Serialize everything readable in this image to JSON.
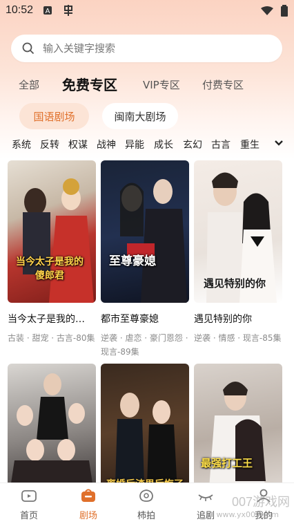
{
  "status": {
    "time": "10:52"
  },
  "search": {
    "placeholder": "输入关键字搜索"
  },
  "tabs": [
    {
      "label": "全部"
    },
    {
      "label": "免费专区"
    },
    {
      "label": "VIP专区"
    },
    {
      "label": "付费专区"
    }
  ],
  "regions": [
    {
      "label": "国语剧场"
    },
    {
      "label": "闽南大剧场"
    }
  ],
  "genres": [
    "系统",
    "反转",
    "权谋",
    "战神",
    "异能",
    "成长",
    "玄幻",
    "古言",
    "重生"
  ],
  "cards": [
    {
      "title": "当今太子是我的…",
      "tags": "古装 · 甜宠 · 古言-80集",
      "poster_text": "当今太子是我的傻郎君"
    },
    {
      "title": "都市至尊豪媳",
      "tags": "逆袭 · 虐恋 · 豪门恩怨 · 现言-89集",
      "poster_text": "至尊豪媳"
    },
    {
      "title": "遇见特别的你",
      "tags": "逆袭 · 情感 · 现言-85集",
      "poster_text": "遇见特别的你"
    },
    {
      "title": "",
      "tags": "",
      "poster_text": ""
    },
    {
      "title": "",
      "tags": "",
      "poster_text": "离婚后渣男后悔了"
    },
    {
      "title": "",
      "tags": "",
      "poster_text": "最强打工王"
    }
  ],
  "nav": [
    {
      "label": "首页"
    },
    {
      "label": "剧场"
    },
    {
      "label": "柿拍"
    },
    {
      "label": "追剧"
    },
    {
      "label": "我的"
    }
  ],
  "watermark": {
    "main": "007游戏网",
    "sub": "www.yx007.com"
  },
  "colors": {
    "accent": "#e0702b",
    "pill_active_bg": "#fce4d6"
  }
}
